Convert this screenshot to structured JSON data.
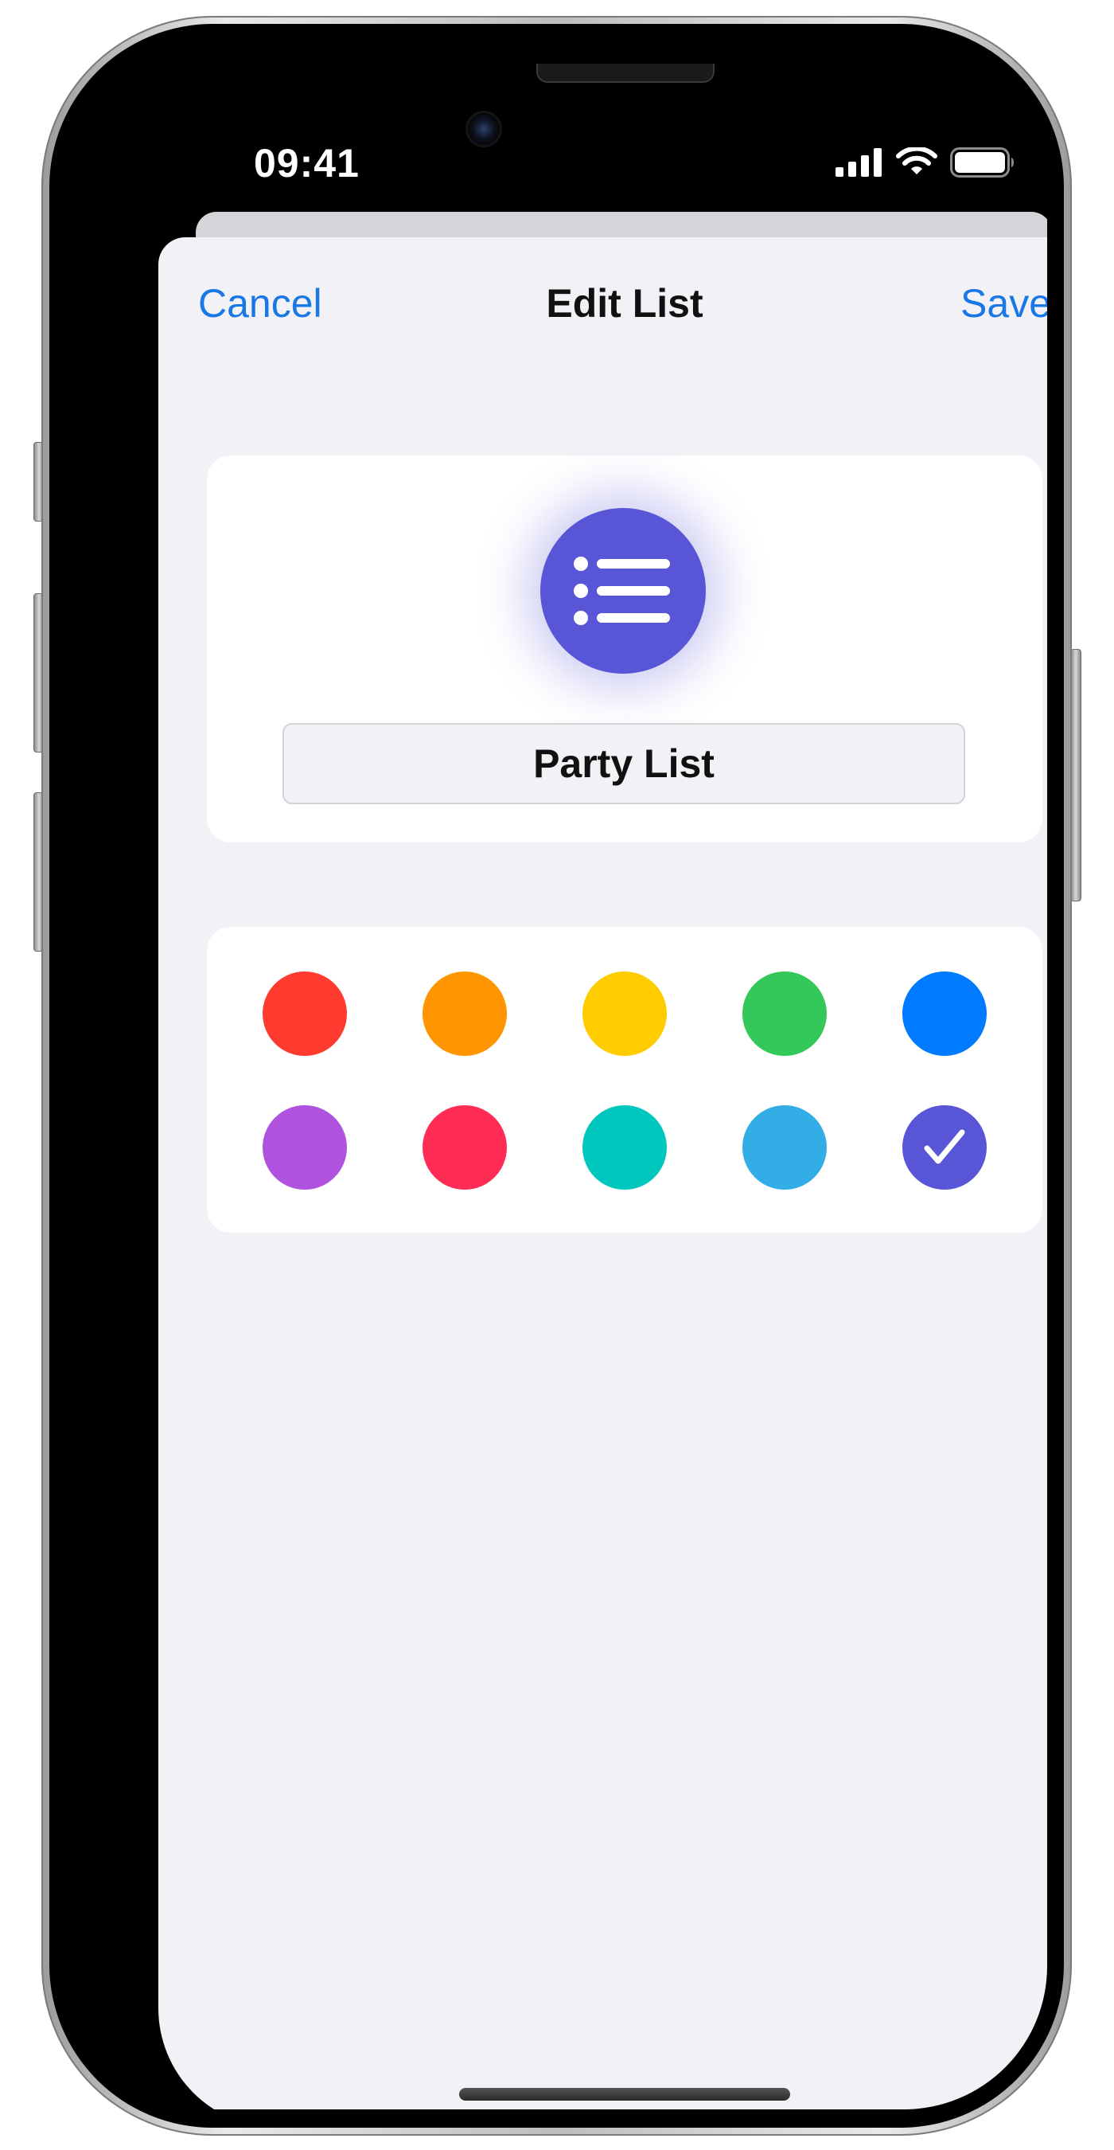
{
  "status_bar": {
    "time": "09:41",
    "icons": [
      "cellular-signal-icon",
      "wifi-icon",
      "battery-icon"
    ]
  },
  "nav": {
    "cancel_label": "Cancel",
    "title": "Edit List",
    "save_label": "Save"
  },
  "list_icon": {
    "icon": "list-bullet-icon",
    "color": "#5856d6"
  },
  "name_field": {
    "value": "Party List"
  },
  "colors": {
    "swatches": [
      {
        "name": "red",
        "hex": "#ff3b30"
      },
      {
        "name": "orange",
        "hex": "#ff9500"
      },
      {
        "name": "yellow",
        "hex": "#ffcc00"
      },
      {
        "name": "green",
        "hex": "#34c759"
      },
      {
        "name": "blue",
        "hex": "#007aff"
      },
      {
        "name": "purple",
        "hex": "#af52de"
      },
      {
        "name": "pink",
        "hex": "#ff2d55"
      },
      {
        "name": "teal",
        "hex": "#00c7be"
      },
      {
        "name": "light-blue",
        "hex": "#32ade6"
      },
      {
        "name": "indigo",
        "hex": "#5856d6"
      }
    ],
    "selected": "indigo",
    "selected_icon": "checkmark-icon"
  },
  "theme": {
    "accent": "#1977e6",
    "sheet_background": "#f1f1f6",
    "card_background": "#ffffff"
  }
}
